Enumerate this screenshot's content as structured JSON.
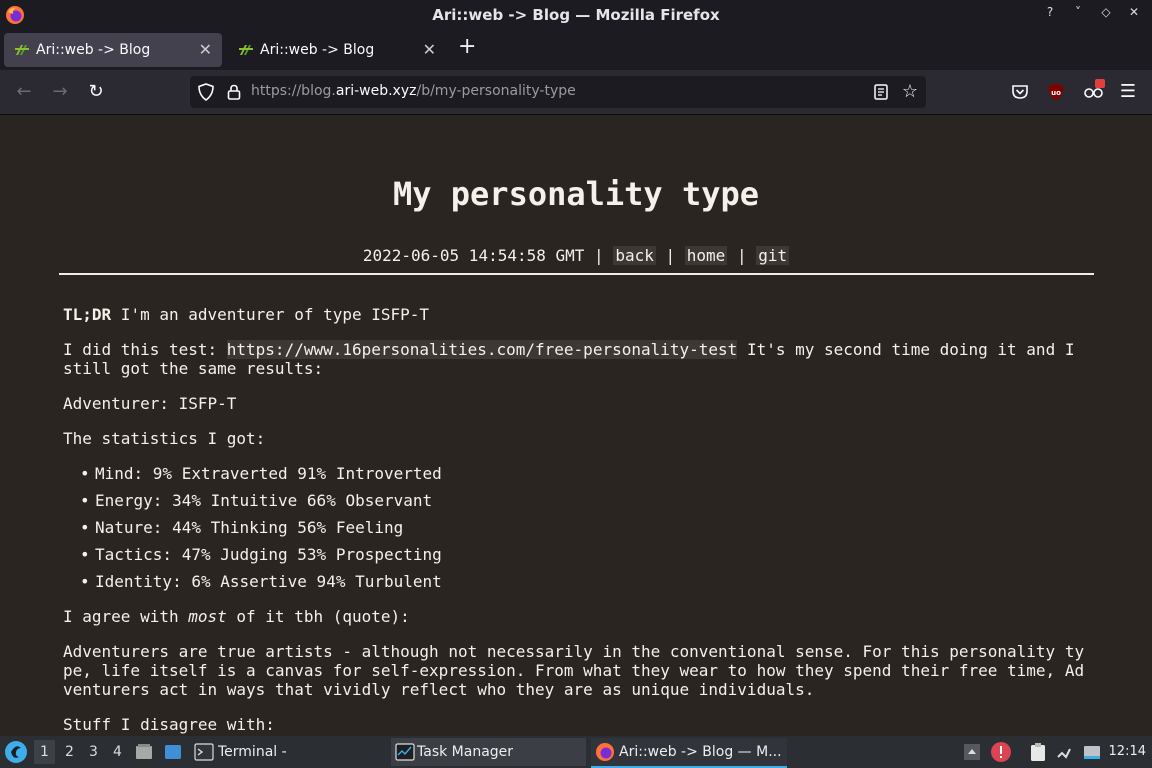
{
  "window": {
    "title": "Ari::web -> Blog — Mozilla Firefox"
  },
  "tabs": [
    {
      "label": "Ari::web -> Blog",
      "active": true
    },
    {
      "label": "Ari::web -> Blog",
      "active": false
    }
  ],
  "toolbar": {
    "url_prefix": "https://blog.",
    "url_domain": "ari-web.xyz",
    "url_path": "/b/my-personality-type"
  },
  "page": {
    "title": "My personality type",
    "timestamp": "2022-06-05 14:54:58 GMT",
    "sep": "|",
    "nav": {
      "back": "back",
      "home": "home",
      "git": "git"
    },
    "tldr_label": "TL;DR",
    "tldr_text": " I'm an adventurer of type ISFP-T",
    "p1_before": "I did this test: ",
    "p1_link": "https://www.16personalities.com/free-personality-test",
    "p1_after": " It's my second time doing it and I still got the same results:",
    "type_line": "Adventurer: ISFP-T",
    "stats_intro": "The statistics I got:",
    "stats": [
      "Mind: 9% Extraverted 91% Introverted",
      "Energy: 34% Intuitive 66% Observant",
      "Nature: 44% Thinking 56% Feeling",
      "Tactics: 47% Judging 53% Prospecting",
      "Identity: 6% Assertive 94% Turbulent"
    ],
    "agree_before": "I agree with ",
    "agree_em": "most",
    "agree_after": " of it tbh (quote):",
    "quote": "Adventurers are true artists - although not necessarily in the conventional sense. For this personality type, life itself is a canvas for self-expression. From what they wear to how they spend their free time, Adventurers act in ways that vividly reflect who they are as unique individuals.",
    "disagree": "Stuff I disagree with:"
  },
  "taskbar": {
    "desktops": [
      "1",
      "2",
      "3",
      "4"
    ],
    "tasks": {
      "terminal": "Terminal -",
      "taskmanager": "Task Manager",
      "firefox": "Ari::web -> Blog — M..."
    },
    "clock": "12:14"
  }
}
